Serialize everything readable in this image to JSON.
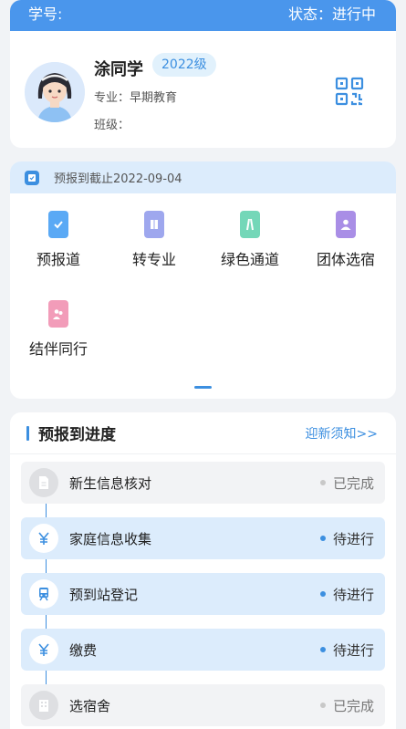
{
  "header": {
    "student_id_label": "学号:",
    "status_text": "状态：进行中"
  },
  "profile": {
    "name": "涂同学",
    "grade": "2022级",
    "major": "专业：早期教育",
    "class": "班级："
  },
  "services": {
    "deadline": "预报到截止2022-09-04",
    "items": [
      {
        "label": "预报道",
        "icon": "phone-check-icon",
        "color": "#5aa9f5"
      },
      {
        "label": "转专业",
        "icon": "book-icon",
        "color": "#9ea7ee"
      },
      {
        "label": "绿色通道",
        "icon": "road-icon",
        "color": "#74d7b8"
      },
      {
        "label": "团体选宿",
        "icon": "person-icon",
        "color": "#a98ee6"
      },
      {
        "label": "结伴同行",
        "icon": "companion-icon",
        "color": "#f29cb9"
      }
    ]
  },
  "progress": {
    "title": "预报到进度",
    "notice_link": "迎新须知>>",
    "steps": [
      {
        "name": "新生信息核对",
        "status": "已完成",
        "icon": "document-icon"
      },
      {
        "name": "家庭信息收集",
        "status": "待进行",
        "icon": "yuan-icon"
      },
      {
        "name": "预到站登记",
        "status": "待进行",
        "icon": "train-icon"
      },
      {
        "name": "缴费",
        "status": "待进行",
        "icon": "yuan-icon"
      },
      {
        "name": "选宿舍",
        "status": "已完成",
        "icon": "building-icon"
      }
    ]
  },
  "colors": {
    "accent": "#3c8fe0",
    "header_bar": "#4a96ec",
    "pending_bg": "#dcecfc",
    "done_bg": "#f2f3f5"
  }
}
